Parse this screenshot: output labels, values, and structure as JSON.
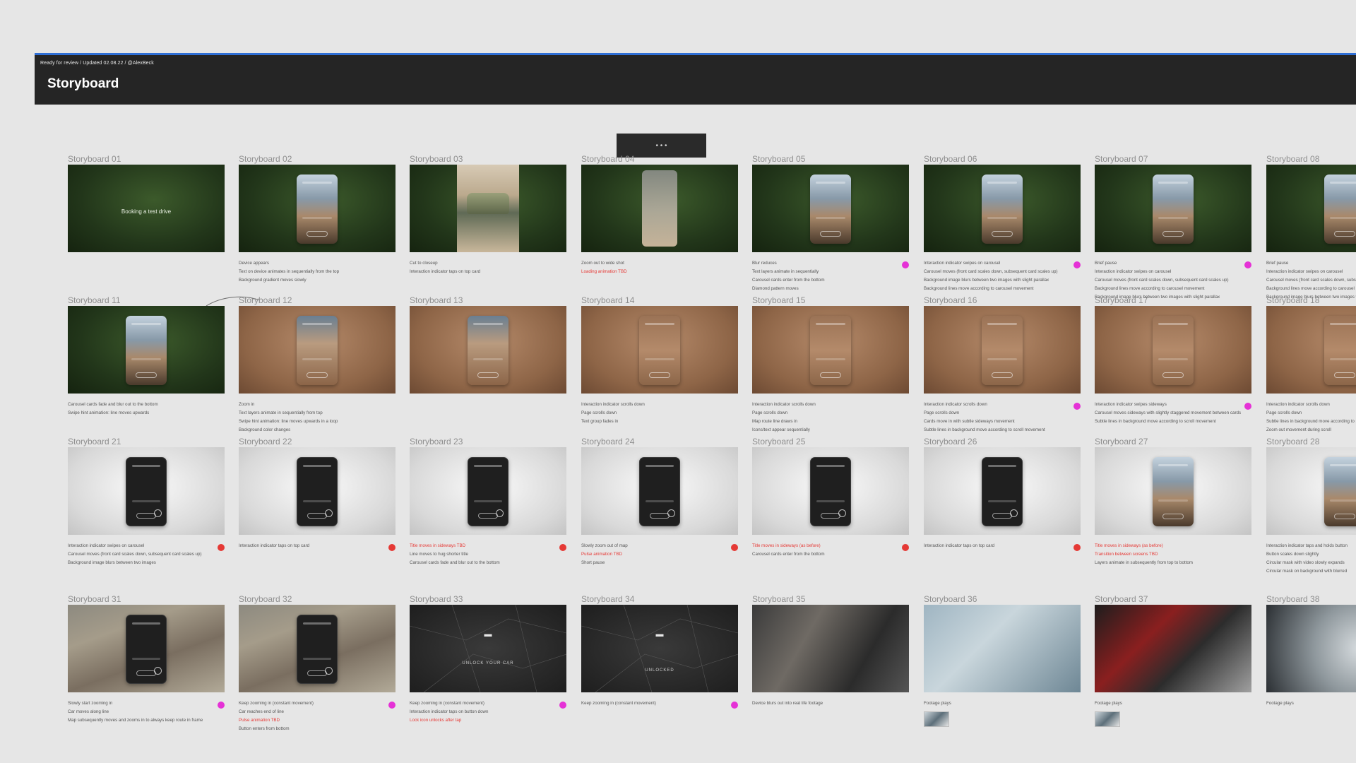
{
  "header": {
    "breadcrumb": "Ready for review  /  Updated 02.08.22  /  @AlexBeck",
    "title": "Storyboard"
  },
  "toolbar": {
    "dots": "•   •   •"
  },
  "colors": {
    "accent_blue": "#2f6fd6",
    "dot_magenta": "#e532d6",
    "dot_red": "#e53935",
    "note_red": "#e53935"
  },
  "frames": [
    {
      "label": "Storyboard 01",
      "thumb_text": "Booking a test drive",
      "notes": []
    },
    {
      "label": "Storyboard 02",
      "notes": [
        {
          "text": "Device appears"
        },
        {
          "text": "Text on device animates in sequentially from the top"
        },
        {
          "text": "Background gradient moves slowly"
        }
      ]
    },
    {
      "label": "Storyboard 03",
      "notes": [
        {
          "text": "Cut to closeup"
        },
        {
          "text": "Interaction indicator taps on top card"
        }
      ]
    },
    {
      "label": "Storyboard 04",
      "notes": [
        {
          "text": "Zoom out to wide shot"
        },
        {
          "text": "Loading animation TBD",
          "red": true
        }
      ]
    },
    {
      "label": "Storyboard 05",
      "dot": "magenta",
      "notes": [
        {
          "text": "Blur reduces"
        },
        {
          "text": "Text layers animate in sequentially"
        },
        {
          "text": "Carousel cards enter from the bottom"
        },
        {
          "text": "Diamond pattern moves"
        }
      ]
    },
    {
      "label": "Storyboard 06",
      "dot": "magenta",
      "notes": [
        {
          "text": "Interaction indicator swipes on carousel"
        },
        {
          "text": "Carousel moves (front card scales down, subsequent card scales up)"
        },
        {
          "text": "Background image blurs between two images with slight parallax"
        },
        {
          "text": "Background lines move according to carousel movement"
        }
      ]
    },
    {
      "label": "Storyboard 07",
      "dot": "magenta",
      "notes": [
        {
          "text": "Brief pause"
        },
        {
          "text": "Interaction indicator swipes on carousel"
        },
        {
          "text": "Carousel moves (front card scales down, subsequent card scales up)"
        },
        {
          "text": "Background lines move according to carousel movement"
        },
        {
          "text": "Background image blurs between two images with slight parallax"
        }
      ]
    },
    {
      "label": "Storyboard 08",
      "notes": [
        {
          "text": "Brief pause"
        },
        {
          "text": "Interaction indicator swipes on carousel"
        },
        {
          "text": "Carousel moves (front card scales down, subsequent card scales up)"
        },
        {
          "text": "Background lines move according to carousel movement"
        },
        {
          "text": "Background image blurs between two images with slight parallax"
        }
      ]
    },
    {
      "label": "Storyboard 11",
      "notes": [
        {
          "text": "Carousel cards fade and blur out to the bottom"
        },
        {
          "text": "Swipe hint animation: line moves upwards"
        }
      ]
    },
    {
      "label": "Storyboard 12",
      "notes": [
        {
          "text": "Zoom in"
        },
        {
          "text": "Text layers animate in sequentially from top"
        },
        {
          "text": "Swipe hint animation: line moves upwards in a loop"
        },
        {
          "text": "Background color changes"
        }
      ]
    },
    {
      "label": "Storyboard 13",
      "notes": []
    },
    {
      "label": "Storyboard 14",
      "notes": [
        {
          "text": "Interaction indicator scrolls down"
        },
        {
          "text": "Page scrolls down"
        },
        {
          "text": "Text group fades in"
        }
      ]
    },
    {
      "label": "Storyboard 15",
      "notes": [
        {
          "text": "Interaction indicator scrolls down"
        },
        {
          "text": "Page scrolls down"
        },
        {
          "text": "Map route line draws in"
        },
        {
          "text": "Icons/text appear sequentially"
        }
      ]
    },
    {
      "label": "Storyboard 16",
      "dot": "magenta",
      "notes": [
        {
          "text": "Interaction indicator scrolls down"
        },
        {
          "text": "Page scrolls down"
        },
        {
          "text": "Cards move in with subtle sideways movement"
        },
        {
          "text": "Subtle lines in background move according to scroll movement"
        }
      ]
    },
    {
      "label": "Storyboard 17",
      "dot": "magenta",
      "notes": [
        {
          "text": "Interaction indicator swipes sideways"
        },
        {
          "text": "Carousel moves sideways with slightly staggered movement between cards"
        },
        {
          "text": "Subtle lines in background move according to scroll movement"
        }
      ]
    },
    {
      "label": "Storyboard 18",
      "notes": [
        {
          "text": "Interaction indicator scrolls down"
        },
        {
          "text": "Page scrolls down"
        },
        {
          "text": "Subtle lines in background move according to scroll"
        },
        {
          "text": "Zoom out movement during scroll"
        }
      ]
    },
    {
      "label": "Storyboard 21",
      "dot": "red",
      "notes": [
        {
          "text": "Interaction indicator swipes on carousel"
        },
        {
          "text": "Carousel moves (front card scales down, subsequent card scales up)"
        },
        {
          "text": "Background image blurs between two images"
        }
      ]
    },
    {
      "label": "Storyboard 22",
      "dot": "red",
      "notes": [
        {
          "text": "Interaction indicator taps on top card"
        }
      ]
    },
    {
      "label": "Storyboard 23",
      "dot": "red",
      "notes": [
        {
          "text": "Title moves in sideways TBD",
          "red": true
        },
        {
          "text": "Line moves to hug shorter title"
        },
        {
          "text": "Carousel cards fade and blur out to the bottom"
        }
      ]
    },
    {
      "label": "Storyboard 24",
      "dot": "red",
      "notes": [
        {
          "text": "Slowly zoom out of map"
        },
        {
          "text": "Pulse animation TBD",
          "red": true
        },
        {
          "text": "Short pause"
        }
      ]
    },
    {
      "label": "Storyboard 25",
      "dot": "red",
      "notes": [
        {
          "text": "Title moves in sideways (as before)",
          "red": true
        },
        {
          "text": "Carousel cards enter from the bottom"
        }
      ]
    },
    {
      "label": "Storyboard 26",
      "dot": "red",
      "notes": [
        {
          "text": "Interaction indicator taps on top card"
        }
      ]
    },
    {
      "label": "Storyboard 27",
      "notes": [
        {
          "text": "Title moves in sideways (as before)",
          "red": true
        },
        {
          "text": "Transition between screens TBD",
          "red": true
        },
        {
          "text": "Layers animate in subsequently from top to bottom"
        }
      ]
    },
    {
      "label": "Storyboard 28",
      "notes": [
        {
          "text": "Interaction indicator taps and holds button"
        },
        {
          "text": "Button scales down slightly"
        },
        {
          "text": "Circular mask with video slowly expands"
        },
        {
          "text": "Circular mask on background with blurred"
        }
      ]
    },
    {
      "label": "Storyboard 31",
      "dot": "magenta",
      "notes": [
        {
          "text": "Slowly start zooming in"
        },
        {
          "text": "Car moves along line"
        },
        {
          "text": "Map subsequently moves and zooms in to always keep route in frame"
        }
      ]
    },
    {
      "label": "Storyboard 32",
      "dot": "magenta",
      "notes": [
        {
          "text": "Keep zooming in (constant movement)"
        },
        {
          "text": "Car reaches end of line"
        },
        {
          "text": "Pulse animation TBD",
          "red": true
        },
        {
          "text": "Button enters from bottom"
        }
      ]
    },
    {
      "label": "Storyboard 33",
      "dot": "magenta",
      "thumb_text": "UNLOCK YOUR CAR",
      "notes": [
        {
          "text": "Keep zooming in (constant movement)"
        },
        {
          "text": "Interaction indicator taps on button down"
        },
        {
          "text": "Lock icon unlocks after tap",
          "red": true
        }
      ]
    },
    {
      "label": "Storyboard 34",
      "dot": "magenta",
      "thumb_text": "UNLOCKED",
      "notes": [
        {
          "text": "Keep zooming in (constant movement)"
        }
      ]
    },
    {
      "label": "Storyboard 35",
      "notes": [
        {
          "text": "Device blurs out into real life footage"
        }
      ]
    },
    {
      "label": "Storyboard 36",
      "notes": [
        {
          "text": "Footage plays"
        }
      ]
    },
    {
      "label": "Storyboard 37",
      "notes": [
        {
          "text": "Footage plays"
        }
      ]
    },
    {
      "label": "Storyboard 38",
      "notes": [
        {
          "text": "Footage plays"
        }
      ]
    }
  ]
}
